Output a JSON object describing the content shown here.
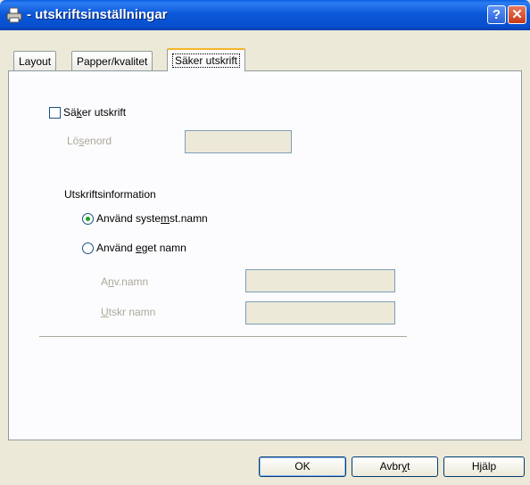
{
  "window": {
    "title": " - utskriftsinställningar",
    "help_label": "?",
    "close_label": "✕",
    "icon": "printer-icon"
  },
  "tabs": [
    {
      "label": "Layout"
    },
    {
      "label": "Papper/kvalitet"
    },
    {
      "label": "Säker utskrift",
      "active": true
    }
  ],
  "secure": {
    "checkbox_label_pre": "Sä",
    "checkbox_label_acc": "k",
    "checkbox_label_post": "er utskrift",
    "checked": false,
    "password_label_pre": "Lö",
    "password_label_acc": "s",
    "password_label_post": "enord",
    "password_value": ""
  },
  "print_info": {
    "heading": "Utskriftsinformation",
    "option1_pre": "Använd syste",
    "option1_acc": "m",
    "option1_post": "st.namn",
    "option1_selected": true,
    "option2_pre": "Använd ",
    "option2_acc": "e",
    "option2_post": "get namn",
    "option2_selected": false,
    "username_label_pre": "A",
    "username_label_acc": "n",
    "username_label_post": "v.namn",
    "username_value": "",
    "jobname_label_acc": "U",
    "jobname_label_post": "tskr namn",
    "jobname_value": ""
  },
  "buttons": {
    "ok": "OK",
    "cancel_pre": "Avbr",
    "cancel_acc": "y",
    "cancel_post": "t",
    "help": "Hjälp"
  },
  "colors": {
    "titlebar": "#0a5fe0",
    "tab_highlight": "#f5b52b",
    "radio_dot": "#21a121",
    "disabled_text": "#aca899"
  }
}
